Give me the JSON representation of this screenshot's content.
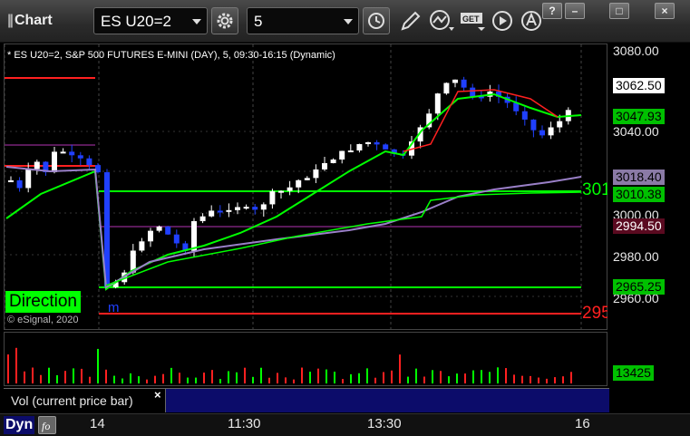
{
  "toolbar": {
    "app_title": "Chart",
    "symbol": "ES U20=2",
    "interval": "5",
    "window_buttons": [
      "?",
      "–",
      "□",
      "×"
    ],
    "icons": [
      "settings-gear-icon",
      "clock-icon",
      "pencil-draw-icon",
      "study-icon",
      "get-icon",
      "play-icon",
      "alert-bell-icon"
    ]
  },
  "chart": {
    "label": "* ES U20=2, S&P 500 FUTURES E-MINI (DAY), 5, 09:30-16:15 (Dynamic)",
    "direction_label": "Direction",
    "copyright": "© eSignal, 2020",
    "edge_label_green": "301",
    "edge_label_red": "295",
    "edge_label_blue": "m"
  },
  "price_axis": {
    "ticks": [
      "3080.00",
      "3040.00",
      "3000.00",
      "2980.00",
      "2960.00"
    ],
    "badges": [
      {
        "label": "3062.50",
        "bg": "#ffffff",
        "fg": "#000000"
      },
      {
        "label": "3047.93",
        "bg": "#00c000",
        "fg": "#000000"
      },
      {
        "label": "3018.40",
        "bg": "#8a7aa6",
        "fg": "#000000"
      },
      {
        "label": "3010.38",
        "bg": "#00c000",
        "fg": "#000000"
      },
      {
        "label": "2994.50",
        "bg": "#5a0a20",
        "fg": "#ffffff"
      },
      {
        "label": "2965.25",
        "bg": "#00c000",
        "fg": "#000000"
      }
    ]
  },
  "volume": {
    "study_label": "Vol (current price bar)",
    "badge": "13425"
  },
  "time_axis": {
    "mode": "Dyn",
    "ticks": [
      "14",
      "11:30",
      "13:30",
      "16"
    ]
  },
  "colors": {
    "up_candle": "#ffffff",
    "down_candle": "#2040ff",
    "ma_fast": "#00ff00",
    "ma_slow": "#9a80c8",
    "red_line": "#ff2020",
    "level_green": "#00ff00",
    "level_purple": "#5a1a5a"
  }
}
